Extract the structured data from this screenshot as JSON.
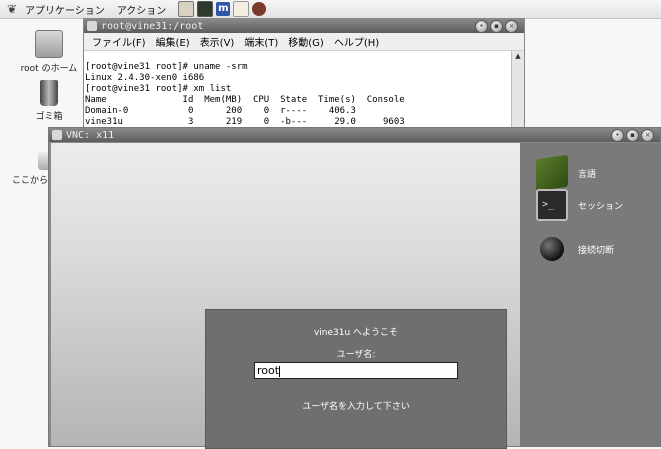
{
  "panel": {
    "menus": [
      "アプリケーション",
      "アクション"
    ]
  },
  "desktop": {
    "icons": [
      {
        "label": "root のホーム"
      },
      {
        "label": "ゴミ箱"
      },
      {
        "label": "ここから"
      }
    ]
  },
  "terminal": {
    "title": "root@vine31:/root",
    "menu": [
      "ファイル(F)",
      "編集(E)",
      "表示(V)",
      "端末(T)",
      "移動(G)",
      "ヘルプ(H)"
    ],
    "lines": [
      "[root@vine31 root]# uname -srm",
      "Linux 2.4.30-xen0 i686",
      "[root@vine31 root]# xm list",
      "Name              Id  Mem(MB)  CPU  State  Time(s)  Console",
      "Domain-0           0      200    0  r----    406.3",
      "vine31u            3      219    0  -b---     29.0     9603"
    ]
  },
  "vnc": {
    "title": "VNC: x11",
    "sidebar": [
      {
        "label": "言語",
        "icon": "books-icon"
      },
      {
        "label": "セッション",
        "icon": "terminal-icon"
      },
      {
        "label": "接続切断",
        "icon": "bomb-icon"
      }
    ],
    "login": {
      "welcome": "vine31u へようこそ",
      "username_label": "ユーザ名:",
      "username_value": "root",
      "hint": "ユーザ名を入力して下さい"
    }
  }
}
